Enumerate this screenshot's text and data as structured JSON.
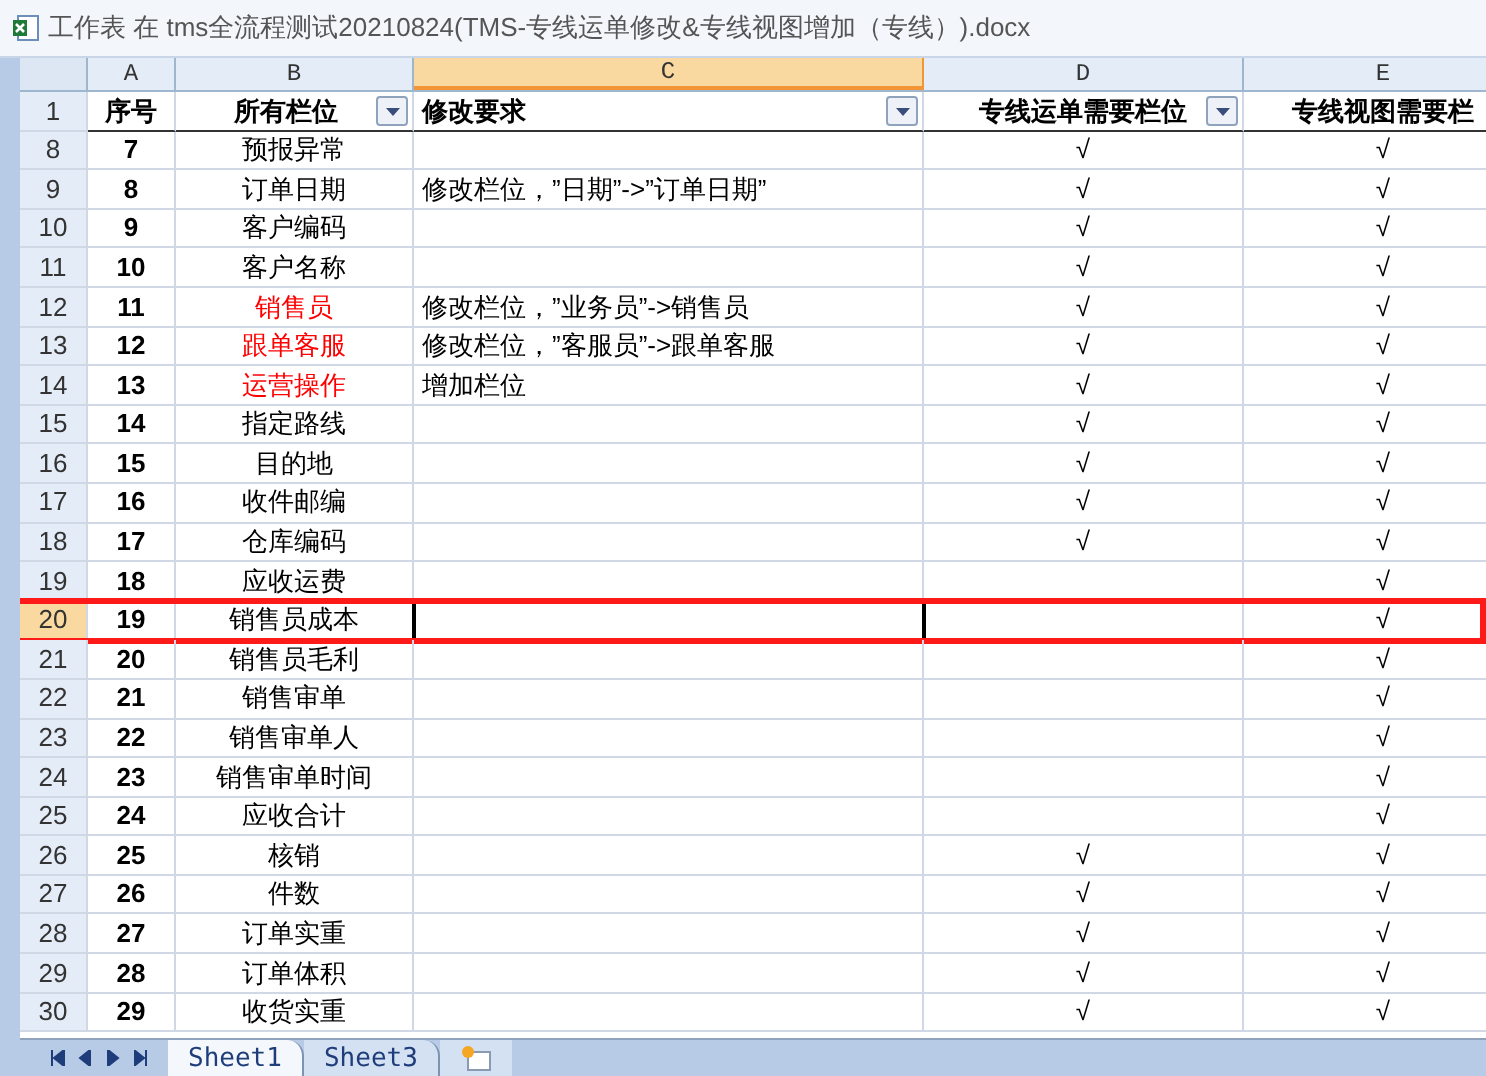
{
  "window": {
    "title": "工作表 在 tms全流程测试20210824(TMS-专线运单修改&专线视图增加（专线）).docx"
  },
  "columns": [
    {
      "letter": "A",
      "selected": false
    },
    {
      "letter": "B",
      "selected": false
    },
    {
      "letter": "C",
      "selected": true
    },
    {
      "letter": "D",
      "selected": false
    },
    {
      "letter": "E",
      "selected": false
    }
  ],
  "header_row": {
    "row": "1",
    "cells": [
      {
        "text": "序号",
        "filter": false
      },
      {
        "text": "所有栏位",
        "filter": true
      },
      {
        "text": "修改要求",
        "filter": true
      },
      {
        "text": "专线运单需要栏位",
        "filter": true
      },
      {
        "text": "专线视图需要栏",
        "filter": false
      }
    ]
  },
  "rows": [
    {
      "row": "8",
      "no": "7",
      "field": "预报异常",
      "color": "#000000",
      "d": "√",
      "e": "√",
      "selected": false,
      "marked": false
    },
    {
      "row": "9",
      "no": "8",
      "field": "订单日期",
      "color": "#000000",
      "change": "修改栏位，”日期”->”订单日期”",
      "d": "√",
      "e": "√",
      "selected": false,
      "marked": false
    },
    {
      "row": "10",
      "no": "9",
      "field": "客户编码",
      "color": "#000000",
      "d": "√",
      "e": "√",
      "selected": false,
      "marked": false
    },
    {
      "row": "11",
      "no": "10",
      "field": "客户名称",
      "color": "#000000",
      "d": "√",
      "e": "√",
      "selected": false,
      "marked": false
    },
    {
      "row": "12",
      "no": "11",
      "field": "销售员",
      "color": "#ff0000",
      "change": "修改栏位，”业务员”->销售员",
      "d": "√",
      "e": "√",
      "selected": false,
      "marked": false
    },
    {
      "row": "13",
      "no": "12",
      "field": "跟单客服",
      "color": "#ff0000",
      "change": "修改栏位，”客服员”->跟单客服",
      "d": "√",
      "e": "√",
      "selected": false,
      "marked": false
    },
    {
      "row": "14",
      "no": "13",
      "field": "运营操作",
      "color": "#ff0000",
      "change": "增加栏位",
      "d": "√",
      "e": "√",
      "selected": false,
      "marked": false
    },
    {
      "row": "15",
      "no": "14",
      "field": "指定路线",
      "color": "#000000",
      "d": "√",
      "e": "√",
      "selected": false,
      "marked": false
    },
    {
      "row": "16",
      "no": "15",
      "field": "目的地",
      "color": "#000000",
      "d": "√",
      "e": "√",
      "selected": false,
      "marked": false
    },
    {
      "row": "17",
      "no": "16",
      "field": "收件邮编",
      "color": "#000000",
      "d": "√",
      "e": "√",
      "selected": false,
      "marked": false
    },
    {
      "row": "18",
      "no": "17",
      "field": "仓库编码",
      "color": "#000000",
      "d": "√",
      "e": "√",
      "selected": false,
      "marked": false
    },
    {
      "row": "19",
      "no": "18",
      "field": "应收运费",
      "color": "#000000",
      "e": "√",
      "selected": false,
      "marked": false
    },
    {
      "row": "20",
      "no": "19",
      "field": "销售员成本",
      "color": "#000000",
      "e": "√",
      "selected": true,
      "marked": true
    },
    {
      "row": "21",
      "no": "20",
      "field": "销售员毛利",
      "color": "#000000",
      "e": "√",
      "selected": false,
      "marked": false
    },
    {
      "row": "22",
      "no": "21",
      "field": "销售审单",
      "color": "#000000",
      "e": "√",
      "selected": false,
      "marked": false
    },
    {
      "row": "23",
      "no": "22",
      "field": "销售审单人",
      "color": "#000000",
      "e": "√",
      "selected": false,
      "marked": false
    },
    {
      "row": "24",
      "no": "23",
      "field": "销售审单时间",
      "color": "#000000",
      "e": "√",
      "selected": false,
      "marked": false
    },
    {
      "row": "25",
      "no": "24",
      "field": "应收合计",
      "color": "#000000",
      "e": "√",
      "selected": false,
      "marked": false
    },
    {
      "row": "26",
      "no": "25",
      "field": "核销",
      "color": "#000000",
      "d": "√",
      "e": "√",
      "selected": false,
      "marked": false
    },
    {
      "row": "27",
      "no": "26",
      "field": "件数",
      "color": "#000000",
      "d": "√",
      "e": "√",
      "selected": false,
      "marked": false
    },
    {
      "row": "28",
      "no": "27",
      "field": "订单实重",
      "color": "#000000",
      "d": "√",
      "e": "√",
      "selected": false,
      "marked": false
    },
    {
      "row": "29",
      "no": "28",
      "field": "订单体积",
      "color": "#000000",
      "d": "√",
      "e": "√",
      "selected": false,
      "marked": false
    },
    {
      "row": "30",
      "no": "29",
      "field": "收货实重",
      "color": "#000000",
      "d": "√",
      "e": "√",
      "selected": false,
      "marked": false
    }
  ],
  "sheet_tabs": [
    {
      "label": "Sheet1",
      "selected": true
    },
    {
      "label": "Sheet3",
      "selected": false
    }
  ]
}
